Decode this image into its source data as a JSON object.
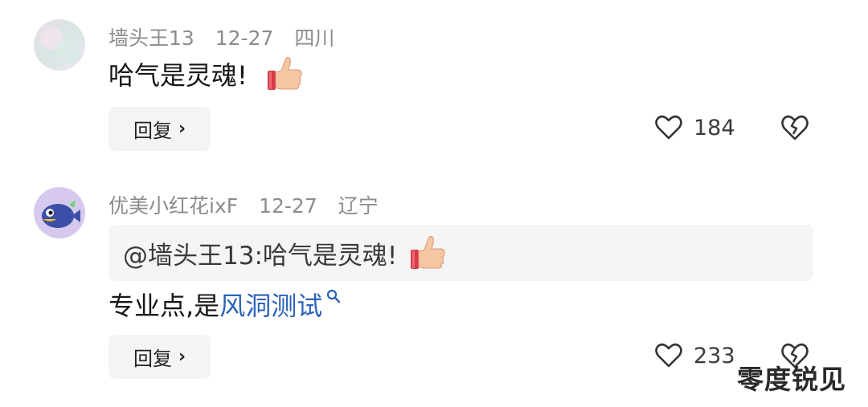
{
  "comments": [
    {
      "username": "墙头王13",
      "date": "12-27",
      "location": "四川",
      "text": "哈气是灵魂!",
      "reply_label": "回复",
      "likes": "184"
    },
    {
      "username": "优美小红花ixF",
      "date": "12-27",
      "location": "辽宁",
      "quote": "@墙头王13:哈气是灵魂!",
      "text_prefix": "专业点,是",
      "text_link": "风洞测试",
      "reply_label": "回复",
      "likes": "233"
    }
  ],
  "watermark": "零度锐见",
  "colors": {
    "link": "#2c62b8",
    "meta": "#8c8c8c",
    "button_bg": "#f4f4f4"
  },
  "icons": [
    "thumbs-up-emoji",
    "heart-icon",
    "broken-heart-icon",
    "chevron-right-icon",
    "search-icon"
  ]
}
